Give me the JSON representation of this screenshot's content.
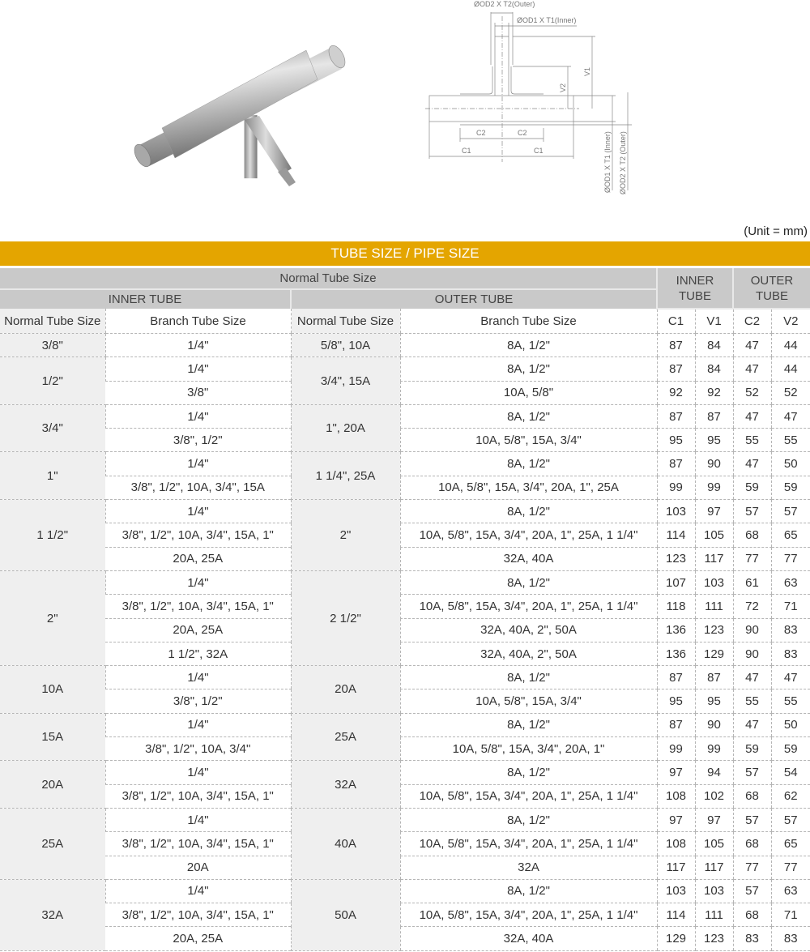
{
  "figure": {
    "product_image": "stainless-steel-jacketed-tee-photo",
    "drawing_labels": {
      "outer_dia": "ØOD2 X T2(Outer)",
      "inner_dia": "ØOD1 X T1(Inner)",
      "v1": "V1",
      "v2": "V2",
      "c1": "C1",
      "c2": "C2",
      "inner_vertical": "ØOD1 X T1 (Inner)",
      "outer_vertical": "ØOD2 X T2 (Outer)"
    }
  },
  "unit_note": "(Unit = mm)",
  "table": {
    "title": "TUBE SIZE / PIPE SIZE",
    "header_normal_tube_size": "Normal Tube Size",
    "header_inner_tube": "INNER TUBE",
    "header_outer_tube": "OUTER TUBE",
    "header_inner_tube_dims": "INNER TUBE",
    "header_outer_tube_dims": "OUTER TUBE",
    "columns": [
      "Normal Tube Size",
      "Branch Tube Size",
      "Normal Tube Size",
      "Branch Tube Size",
      "C1",
      "V1",
      "C2",
      "V2"
    ],
    "accent_color": "#e4a500",
    "groups": [
      {
        "inner": "3/8\"",
        "outer": "5/8\", 10A",
        "rows": [
          {
            "inner_branch": "1/4\"",
            "outer_branch": "8A, 1/2\"",
            "c1": "87",
            "v1": "84",
            "c2": "47",
            "v2": "44"
          }
        ]
      },
      {
        "inner": "1/2\"",
        "outer": "3/4\", 15A",
        "rows": [
          {
            "inner_branch": "1/4\"",
            "outer_branch": "8A, 1/2\"",
            "c1": "87",
            "v1": "84",
            "c2": "47",
            "v2": "44"
          },
          {
            "inner_branch": "3/8\"",
            "outer_branch": "10A, 5/8\"",
            "c1": "92",
            "v1": "92",
            "c2": "52",
            "v2": "52"
          }
        ]
      },
      {
        "inner": "3/4\"",
        "outer": "1\", 20A",
        "rows": [
          {
            "inner_branch": "1/4\"",
            "outer_branch": "8A, 1/2\"",
            "c1": "87",
            "v1": "87",
            "c2": "47",
            "v2": "47"
          },
          {
            "inner_branch": "3/8\", 1/2\"",
            "outer_branch": "10A, 5/8\", 15A, 3/4\"",
            "c1": "95",
            "v1": "95",
            "c2": "55",
            "v2": "55"
          }
        ]
      },
      {
        "inner": "1\"",
        "outer": "1 1/4\", 25A",
        "rows": [
          {
            "inner_branch": "1/4\"",
            "outer_branch": "8A, 1/2\"",
            "c1": "87",
            "v1": "90",
            "c2": "47",
            "v2": "50"
          },
          {
            "inner_branch": "3/8\", 1/2\", 10A, 3/4\", 15A",
            "outer_branch": "10A, 5/8\", 15A, 3/4\", 20A, 1\", 25A",
            "c1": "99",
            "v1": "99",
            "c2": "59",
            "v2": "59"
          }
        ]
      },
      {
        "inner": "1 1/2\"",
        "outer": "2\"",
        "rows": [
          {
            "inner_branch": "1/4\"",
            "outer_branch": "8A, 1/2\"",
            "c1": "103",
            "v1": "97",
            "c2": "57",
            "v2": "57"
          },
          {
            "inner_branch": "3/8\", 1/2\", 10A, 3/4\", 15A, 1\"",
            "outer_branch": "10A, 5/8\", 15A, 3/4\", 20A, 1\", 25A, 1 1/4\"",
            "c1": "114",
            "v1": "105",
            "c2": "68",
            "v2": "65"
          },
          {
            "inner_branch": "20A, 25A",
            "outer_branch": "32A, 40A",
            "c1": "123",
            "v1": "117",
            "c2": "77",
            "v2": "77"
          }
        ]
      },
      {
        "inner": "2\"",
        "outer": "2 1/2\"",
        "rows": [
          {
            "inner_branch": "1/4\"",
            "outer_branch": "8A, 1/2\"",
            "c1": "107",
            "v1": "103",
            "c2": "61",
            "v2": "63"
          },
          {
            "inner_branch": "3/8\", 1/2\", 10A, 3/4\", 15A, 1\"",
            "outer_branch": "10A, 5/8\", 15A, 3/4\", 20A, 1\", 25A, 1 1/4\"",
            "c1": "118",
            "v1": "111",
            "c2": "72",
            "v2": "71"
          },
          {
            "inner_branch": "20A, 25A",
            "outer_branch": "32A, 40A, 2\", 50A",
            "c1": "136",
            "v1": "123",
            "c2": "90",
            "v2": "83"
          },
          {
            "inner_branch": "1 1/2\", 32A",
            "outer_branch": "32A, 40A, 2\", 50A",
            "c1": "136",
            "v1": "129",
            "c2": "90",
            "v2": "83"
          }
        ]
      },
      {
        "inner": "10A",
        "outer": "20A",
        "rows": [
          {
            "inner_branch": "1/4\"",
            "outer_branch": "8A, 1/2\"",
            "c1": "87",
            "v1": "87",
            "c2": "47",
            "v2": "47"
          },
          {
            "inner_branch": "3/8\", 1/2\"",
            "outer_branch": "10A, 5/8\", 15A, 3/4\"",
            "c1": "95",
            "v1": "95",
            "c2": "55",
            "v2": "55"
          }
        ]
      },
      {
        "inner": "15A",
        "outer": "25A",
        "rows": [
          {
            "inner_branch": "1/4\"",
            "outer_branch": "8A, 1/2\"",
            "c1": "87",
            "v1": "90",
            "c2": "47",
            "v2": "50"
          },
          {
            "inner_branch": "3/8\", 1/2\", 10A, 3/4\"",
            "outer_branch": "10A, 5/8\", 15A, 3/4\", 20A, 1\"",
            "c1": "99",
            "v1": "99",
            "c2": "59",
            "v2": "59"
          }
        ]
      },
      {
        "inner": "20A",
        "outer": "32A",
        "rows": [
          {
            "inner_branch": "1/4\"",
            "outer_branch": "8A, 1/2\"",
            "c1": "97",
            "v1": "94",
            "c2": "57",
            "v2": "54"
          },
          {
            "inner_branch": "3/8\", 1/2\", 10A, 3/4\", 15A, 1\"",
            "outer_branch": "10A, 5/8\", 15A, 3/4\", 20A, 1\", 25A, 1 1/4\"",
            "c1": "108",
            "v1": "102",
            "c2": "68",
            "v2": "62"
          }
        ]
      },
      {
        "inner": "25A",
        "outer": "40A",
        "rows": [
          {
            "inner_branch": "1/4\"",
            "outer_branch": "8A, 1/2\"",
            "c1": "97",
            "v1": "97",
            "c2": "57",
            "v2": "57"
          },
          {
            "inner_branch": "3/8\", 1/2\", 10A, 3/4\", 15A, 1\"",
            "outer_branch": "10A, 5/8\", 15A, 3/4\", 20A, 1\", 25A, 1 1/4\"",
            "c1": "108",
            "v1": "105",
            "c2": "68",
            "v2": "65"
          },
          {
            "inner_branch": "20A",
            "outer_branch": "32A",
            "c1": "117",
            "v1": "117",
            "c2": "77",
            "v2": "77"
          }
        ]
      },
      {
        "inner": "32A",
        "outer": "50A",
        "rows": [
          {
            "inner_branch": "1/4\"",
            "outer_branch": "8A, 1/2\"",
            "c1": "103",
            "v1": "103",
            "c2": "57",
            "v2": "63"
          },
          {
            "inner_branch": "3/8\", 1/2\", 10A, 3/4\", 15A, 1\"",
            "outer_branch": "10A, 5/8\", 15A, 3/4\", 20A, 1\", 25A, 1 1/4\"",
            "c1": "114",
            "v1": "111",
            "c2": "68",
            "v2": "71"
          },
          {
            "inner_branch": "20A, 25A",
            "outer_branch": "32A, 40A",
            "c1": "129",
            "v1": "123",
            "c2": "83",
            "v2": "83"
          }
        ]
      }
    ]
  }
}
